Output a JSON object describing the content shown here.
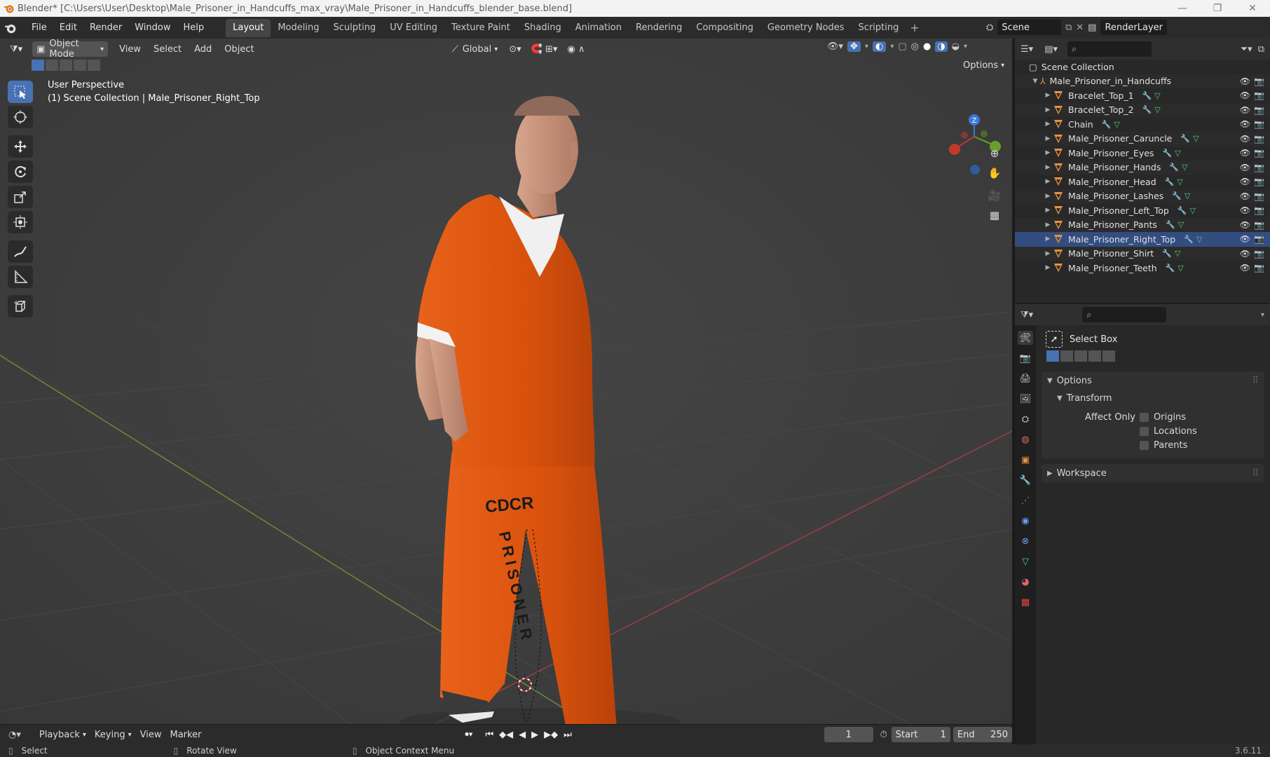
{
  "titlebar": {
    "title": "Blender* [C:\\Users\\User\\Desktop\\Male_Prisoner_in_Handcuffs_max_vray\\Male_Prisoner_in_Handcuffs_blender_base.blend]"
  },
  "menu": {
    "items": [
      "File",
      "Edit",
      "Render",
      "Window",
      "Help"
    ]
  },
  "workspaces": {
    "tabs": [
      "Layout",
      "Modeling",
      "Sculpting",
      "UV Editing",
      "Texture Paint",
      "Shading",
      "Animation",
      "Rendering",
      "Compositing",
      "Geometry Nodes",
      "Scripting"
    ],
    "plus": "+"
  },
  "scene": {
    "name": "Scene",
    "render_layer": "RenderLayer"
  },
  "viewport": {
    "mode": "Object Mode",
    "menus": [
      "View",
      "Select",
      "Add",
      "Object"
    ],
    "orientation": "Global",
    "options": "Options",
    "overlay_line1": "User Perspective",
    "overlay_line2": "(1) Scene Collection | Male_Prisoner_Right_Top",
    "gizmo_z": "Z",
    "shirt_text_1": "CDCR",
    "shirt_text_2": "PRISONER"
  },
  "outliner": {
    "root": "Scene Collection",
    "collection": "Male_Prisoner_in_Handcuffs",
    "items": [
      "Bracelet_Top_1",
      "Bracelet_Top_2",
      "Chain",
      "Male_Prisoner_Caruncle",
      "Male_Prisoner_Eyes",
      "Male_Prisoner_Hands",
      "Male_Prisoner_Head",
      "Male_Prisoner_Lashes",
      "Male_Prisoner_Left_Top",
      "Male_Prisoner_Pants",
      "Male_Prisoner_Right_Top",
      "Male_Prisoner_Shirt",
      "Male_Prisoner_Teeth"
    ],
    "selected_index": 10
  },
  "properties": {
    "tool_name": "Select Box",
    "options_label": "Options",
    "transform_label": "Transform",
    "affect_only_label": "Affect Only",
    "checkboxes": [
      "Origins",
      "Locations",
      "Parents"
    ],
    "workspace_label": "Workspace"
  },
  "timeline": {
    "menus": [
      "Playback",
      "Keying",
      "View",
      "Marker"
    ],
    "current_frame": "1",
    "start_label": "Start",
    "start": "1",
    "end_label": "End",
    "end": "250"
  },
  "status": {
    "select": "Select",
    "rotate": "Rotate View",
    "context": "Object Context Menu",
    "version": "3.6.11"
  },
  "colors": {
    "accent": "#4772b3",
    "orange": "#e35a12",
    "mesh_icon": "#e8913f",
    "background": "#3d3d3d"
  }
}
